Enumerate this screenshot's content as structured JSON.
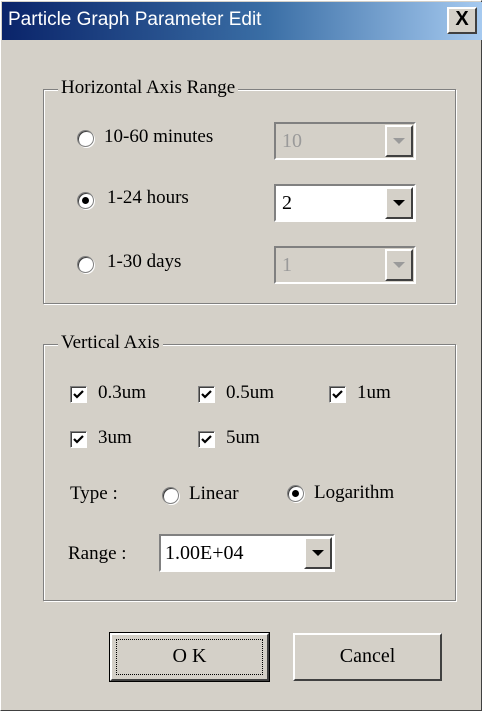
{
  "window": {
    "title": "Particle Graph Parameter Edit",
    "close_glyph": "X"
  },
  "horizontal_axis": {
    "legend": "Horizontal Axis Range",
    "options": [
      {
        "label": "10-60 minutes",
        "checked": false,
        "combo_value": "10",
        "enabled": false
      },
      {
        "label": "1-24 hours",
        "checked": true,
        "combo_value": "2",
        "enabled": true
      },
      {
        "label": "1-30 days",
        "checked": false,
        "combo_value": "1",
        "enabled": false
      }
    ]
  },
  "vertical_axis": {
    "legend": "Vertical Axis",
    "sizes": [
      {
        "label": "0.3um",
        "checked": true
      },
      {
        "label": "0.5um",
        "checked": true
      },
      {
        "label": "1um",
        "checked": true
      },
      {
        "label": "3um",
        "checked": true
      },
      {
        "label": "5um",
        "checked": true
      }
    ],
    "type_label": "Type :",
    "type_options": [
      {
        "label": "Linear",
        "checked": false
      },
      {
        "label": "Logarithm",
        "checked": true
      }
    ],
    "range_label": "Range :",
    "range_value": "1.00E+04"
  },
  "buttons": {
    "ok_label": "O K",
    "cancel_label": "Cancel"
  }
}
